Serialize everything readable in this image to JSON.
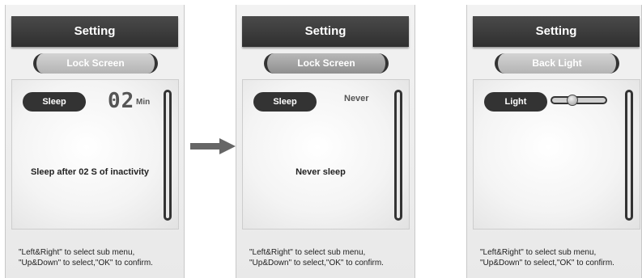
{
  "panels": [
    {
      "title": "Setting",
      "menu_label": "Lock Screen",
      "pill_label": "Sleep",
      "value_big": "02",
      "value_unit": "Min",
      "message": "Sleep after 02 S of inactivity",
      "help_line1": "\"Left&Right\" to select sub menu,",
      "help_line2": "\"Up&Down\" to select,\"OK\" to confirm."
    },
    {
      "title": "Setting",
      "menu_label": "Lock Screen",
      "pill_label": "Sleep",
      "value_text": "Never",
      "message": "Never sleep",
      "help_line1": "\"Left&Right\" to select sub menu,",
      "help_line2": "\"Up&Down\" to select,\"OK\" to confirm."
    },
    {
      "title": "Setting",
      "menu_label": "Back Light",
      "pill_label": "Light",
      "slider_level": 0.35,
      "help_line1": "\"Left&Right\" to select sub menu,",
      "help_line2": "\"Up&Down\" to select,\"OK\" to confirm."
    }
  ],
  "colors": {
    "dark": "#333333",
    "title_bg": "#3b3b3b",
    "menu_bg": "#a9a9a9",
    "arrow": "#666666"
  }
}
